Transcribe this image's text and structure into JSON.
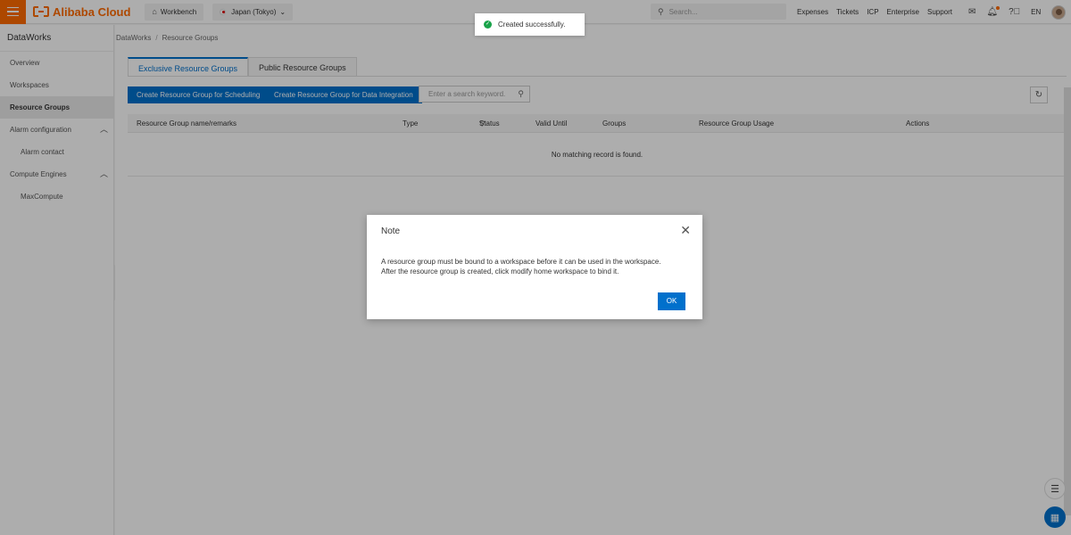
{
  "topbar": {
    "brand": "Alibaba Cloud",
    "workbench_label": "Workbench",
    "region_label": "Japan (Tokyo)",
    "search_placeholder": "Search...",
    "links": [
      "Expenses",
      "Tickets",
      "ICP",
      "Enterprise",
      "Support"
    ],
    "lang": "EN"
  },
  "sidebar": {
    "title": "DataWorks",
    "items": [
      {
        "label": "Overview"
      },
      {
        "label": "Workspaces"
      },
      {
        "label": "Resource Groups"
      },
      {
        "label": "Alarm configuration"
      },
      {
        "label": "Alarm contact"
      },
      {
        "label": "Compute Engines"
      },
      {
        "label": "MaxCompute"
      }
    ]
  },
  "breadcrumb": {
    "root": "DataWorks",
    "sep": "/",
    "current": "Resource Groups"
  },
  "tabs": [
    "Exclusive Resource Groups",
    "Public Resource Groups"
  ],
  "actions": {
    "create_scheduling": "Create Resource Group for Scheduling",
    "create_integration": "Create Resource Group for Data Integration",
    "search_placeholder": "Enter a search keyword."
  },
  "table": {
    "columns": [
      "Resource Group name/remarks",
      "Type",
      "Status",
      "Valid Until",
      "Groups",
      "Resource Group Usage",
      "Actions"
    ],
    "empty_text": "No matching record is found."
  },
  "toast": {
    "text": "Created successfully."
  },
  "modal": {
    "title": "Note",
    "line1": "A resource group must be bound to a workspace before it can be used in the workspace.",
    "line2": "After the resource group is created, click modify home workspace to bind it.",
    "ok_label": "OK"
  },
  "colors": {
    "brand": "#ff6a00",
    "primary": "#0070cc",
    "success": "#1aa34a"
  }
}
